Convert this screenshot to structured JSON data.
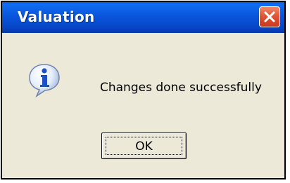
{
  "dialog": {
    "title": "Valuation",
    "message": "Changes done successfully",
    "icon": "information-icon",
    "ok_label": "OK"
  },
  "colors": {
    "titlebar": "#0a55dc",
    "background": "#ece9d8",
    "close_button": "#e0563a"
  }
}
